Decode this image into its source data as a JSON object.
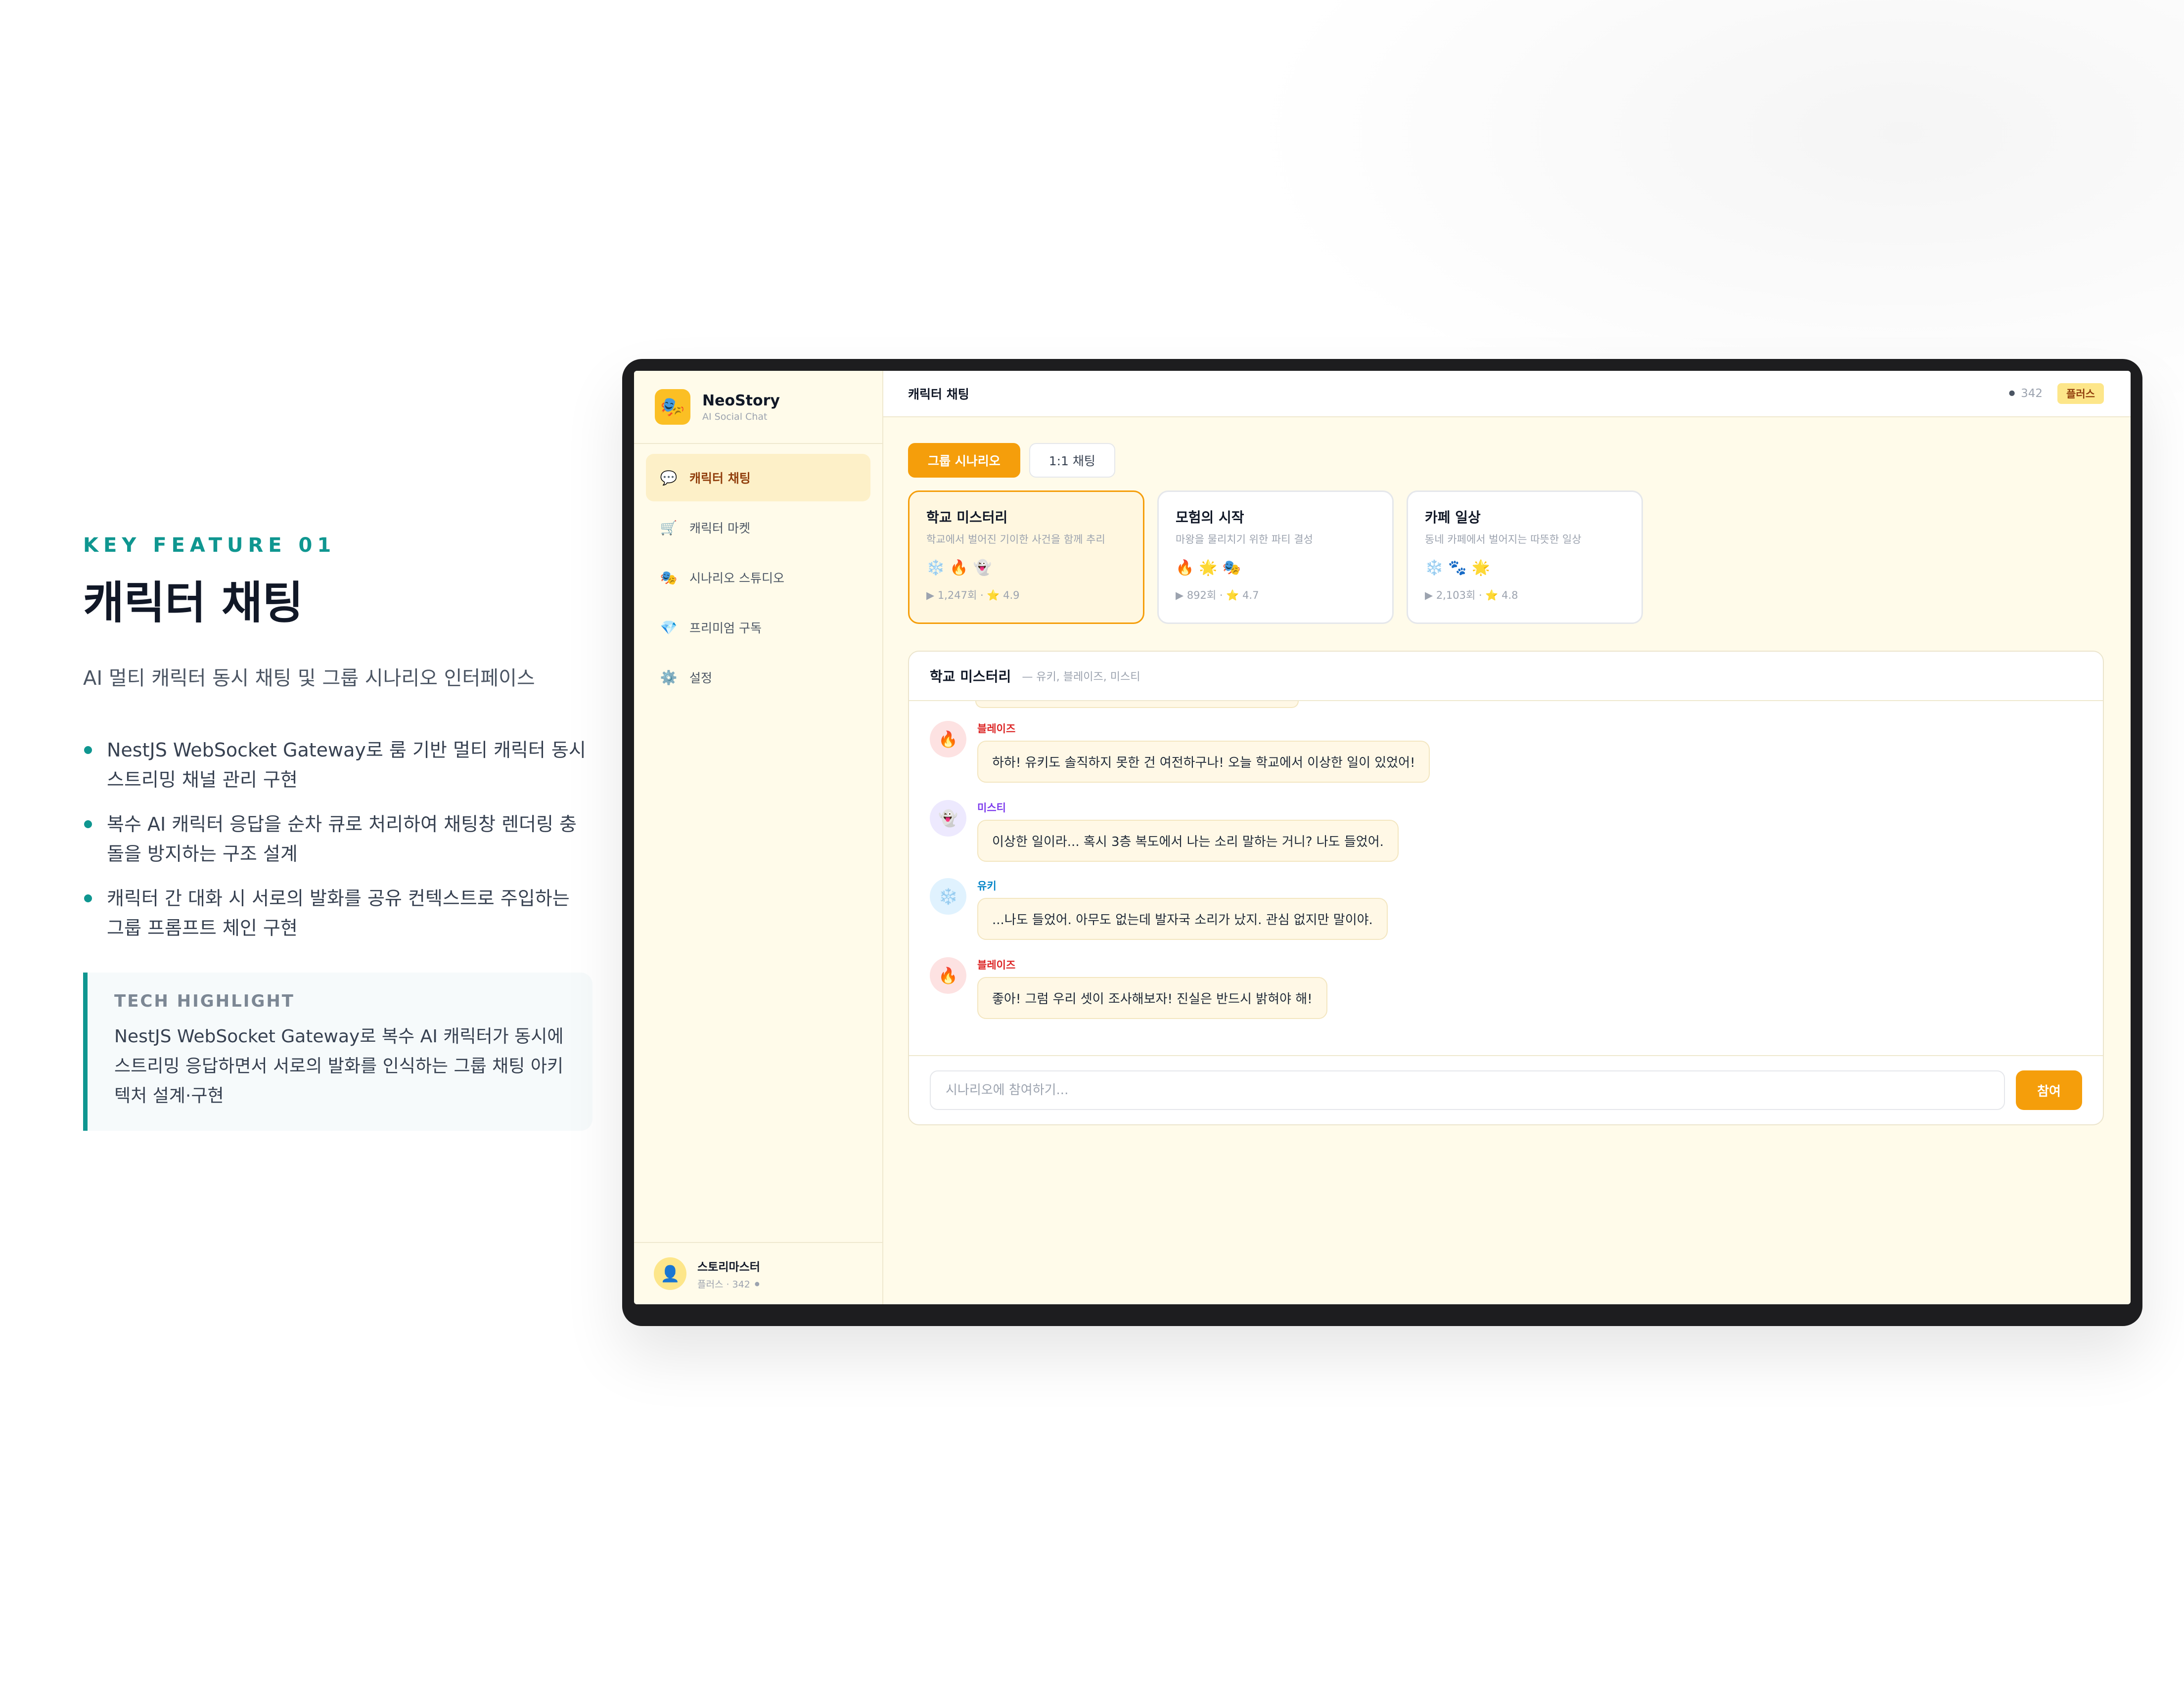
{
  "feature": {
    "kicker": "KEY FEATURE 01",
    "title": "캐릭터 채팅",
    "subtitle": "AI 멀티 캐릭터 동시 채팅 및 그룹 시나리오 인터페이스",
    "bullets": [
      "NestJS WebSocket Gateway로 룸 기반 멀티 캐릭터 동시 스트리밍 채널 관리 구현",
      "복수 AI 캐릭터 응답을 순차 큐로 처리하여 채팅창 렌더링 충돌을 방지하는 구조 설계",
      "캐릭터 간 대화 시 서로의 발화를 공유 컨텍스트로 주입하는 그룹 프롬프트 체인 구현"
    ],
    "highlight_label": "TECH HIGHLIGHT",
    "highlight_text": "NestJS WebSocket Gateway로 복수 AI 캐릭터가 동시에 스트리밍 응답하면서 서로의 발화를 인식하는 그룹 채팅 아키텍처 설계·구현"
  },
  "app": {
    "brand_name": "NeoStory",
    "brand_tagline": "AI Social Chat",
    "brand_icon": "🎭",
    "nav": [
      {
        "label": "캐릭터 채팅",
        "icon": "💬",
        "active": true
      },
      {
        "label": "캐릭터 마켓",
        "icon": "🛒",
        "active": false
      },
      {
        "label": "시나리오 스튜디오",
        "icon": "🎭",
        "active": false
      },
      {
        "label": "프리미엄 구독",
        "icon": "💎",
        "active": false
      },
      {
        "label": "설정",
        "icon": "⚙️",
        "active": false
      }
    ],
    "user": {
      "name": "스토리마스터",
      "meta": "플러스 · 342 ⚫",
      "avatar": "👤"
    },
    "topbar": {
      "title": "캐릭터 채팅",
      "coin_icon": "⚫",
      "coins": "342",
      "plan": "플러스"
    },
    "tabs": [
      "그룹 시나리오",
      "1:1 채팅"
    ],
    "scenarios": [
      {
        "title": "학교 미스터리",
        "desc": "학교에서 벌어진 기이한 사건을 함께 추리",
        "icons": "❄️🔥👻",
        "stats": "▶ 1,247회 · ⭐ 4.9"
      },
      {
        "title": "모험의 시작",
        "desc": "마왕을 물리치기 위한 파티 결성",
        "icons": "🔥🌟🎭",
        "stats": "▶ 892회 · ⭐ 4.7"
      },
      {
        "title": "카페 일상",
        "desc": "동네 카페에서 벌어지는 따뜻한 일상",
        "icons": "❄️🐾🌟",
        "stats": "▶ 2,103회 · ⭐ 4.8"
      }
    ],
    "chat": {
      "title": "학교 미스터리",
      "members": "— 유키, 블레이즈, 미스티",
      "messages": [
        {
          "name": "블레이즈",
          "avatar": "🔥",
          "color": "#dc2626",
          "avatar_bg": "#fde2e2",
          "text": "하하! 유키도 솔직하지 못한 건 여전하구나! 오늘 학교에서 이상한 일이 있었어!"
        },
        {
          "name": "미스티",
          "avatar": "👻",
          "color": "#7c3aed",
          "avatar_bg": "#ede9fe",
          "text": "이상한 일이라... 혹시 3층 복도에서 나는 소리 말하는 거니? 나도 들었어."
        },
        {
          "name": "유키",
          "avatar": "❄️",
          "color": "#0284c7",
          "avatar_bg": "#e0f2fe",
          "text": "...나도 들었어. 아무도 없는데 발자국 소리가 났지. 관심 없지만 말이야."
        },
        {
          "name": "블레이즈",
          "avatar": "🔥",
          "color": "#dc2626",
          "avatar_bg": "#fde2e2",
          "text": "좋아! 그럼 우리 셋이 조사해보자! 진실은 반드시 밝혀야 해!"
        }
      ],
      "input_placeholder": "시나리오에 참여하기...",
      "send_label": "참여"
    }
  }
}
